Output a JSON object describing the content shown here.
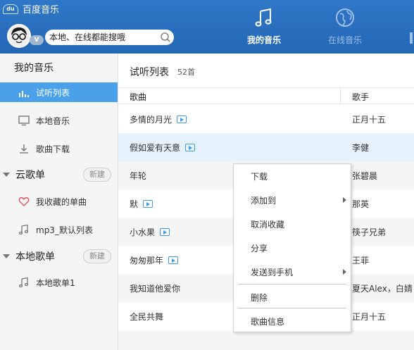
{
  "header": {
    "app_name": "百度音乐",
    "logo_text": "du",
    "vip_badge": "V",
    "search": {
      "placeholder": "本地、在线都能搜哦"
    },
    "nav_tabs": [
      {
        "label": "我的音乐",
        "icon": "music-note-icon",
        "active": true
      },
      {
        "label": "在线音乐",
        "icon": "globe-icon",
        "active": false
      }
    ]
  },
  "sidebar": {
    "heading": "我的音乐",
    "my_music_items": [
      {
        "label": "试听列表",
        "icon": "equalizer-icon",
        "active": true
      },
      {
        "label": "本地音乐",
        "icon": "monitor-icon",
        "active": false
      },
      {
        "label": "歌曲下载",
        "icon": "download-icon",
        "active": false
      }
    ],
    "cloud_section": {
      "label": "云歌单",
      "new_label": "新建"
    },
    "cloud_items": [
      {
        "label": "我收藏的单曲",
        "icon": "heart-icon"
      },
      {
        "label": "mp3_默认列表",
        "icon": "music-note-icon"
      }
    ],
    "local_section": {
      "label": "本地歌单",
      "new_label": "新建"
    },
    "local_items": [
      {
        "label": "本地歌单1",
        "icon": "music-note-icon"
      }
    ]
  },
  "main": {
    "title": "试听列表",
    "count": "52首",
    "columns": {
      "song": "歌曲",
      "artist": "歌手"
    },
    "songs": [
      {
        "title": "多情的月光",
        "artist": "正月十五",
        "mv": true
      },
      {
        "title": "假如爱有天意",
        "artist": "李健",
        "mv": true
      },
      {
        "title": "年轮",
        "artist": "张碧晨",
        "mv": false
      },
      {
        "title": "默",
        "artist": "那英",
        "mv": true
      },
      {
        "title": "小水果",
        "artist": "筷子兄弟",
        "mv": true
      },
      {
        "title": "匆匆那年",
        "artist": "王菲",
        "mv": true
      },
      {
        "title": "我知道他爱你",
        "artist": "夏天Alex，白婧",
        "mv": false
      },
      {
        "title": "全民共舞",
        "artist": "正月十五",
        "mv": false
      }
    ]
  },
  "context_menu": {
    "items": [
      {
        "label": "下载",
        "submenu": false
      },
      {
        "label": "添加到",
        "submenu": true
      },
      {
        "label": "取消收藏",
        "submenu": false
      },
      {
        "label": "分享",
        "submenu": false
      },
      {
        "label": "发送到手机",
        "submenu": true
      },
      {
        "label": "删除",
        "submenu": false
      },
      {
        "label": "歌曲信息",
        "submenu": false
      }
    ]
  },
  "colors": {
    "header": "#2a6fc0",
    "accent": "#4aa1ea",
    "selected_row": "#e5f1fb"
  }
}
